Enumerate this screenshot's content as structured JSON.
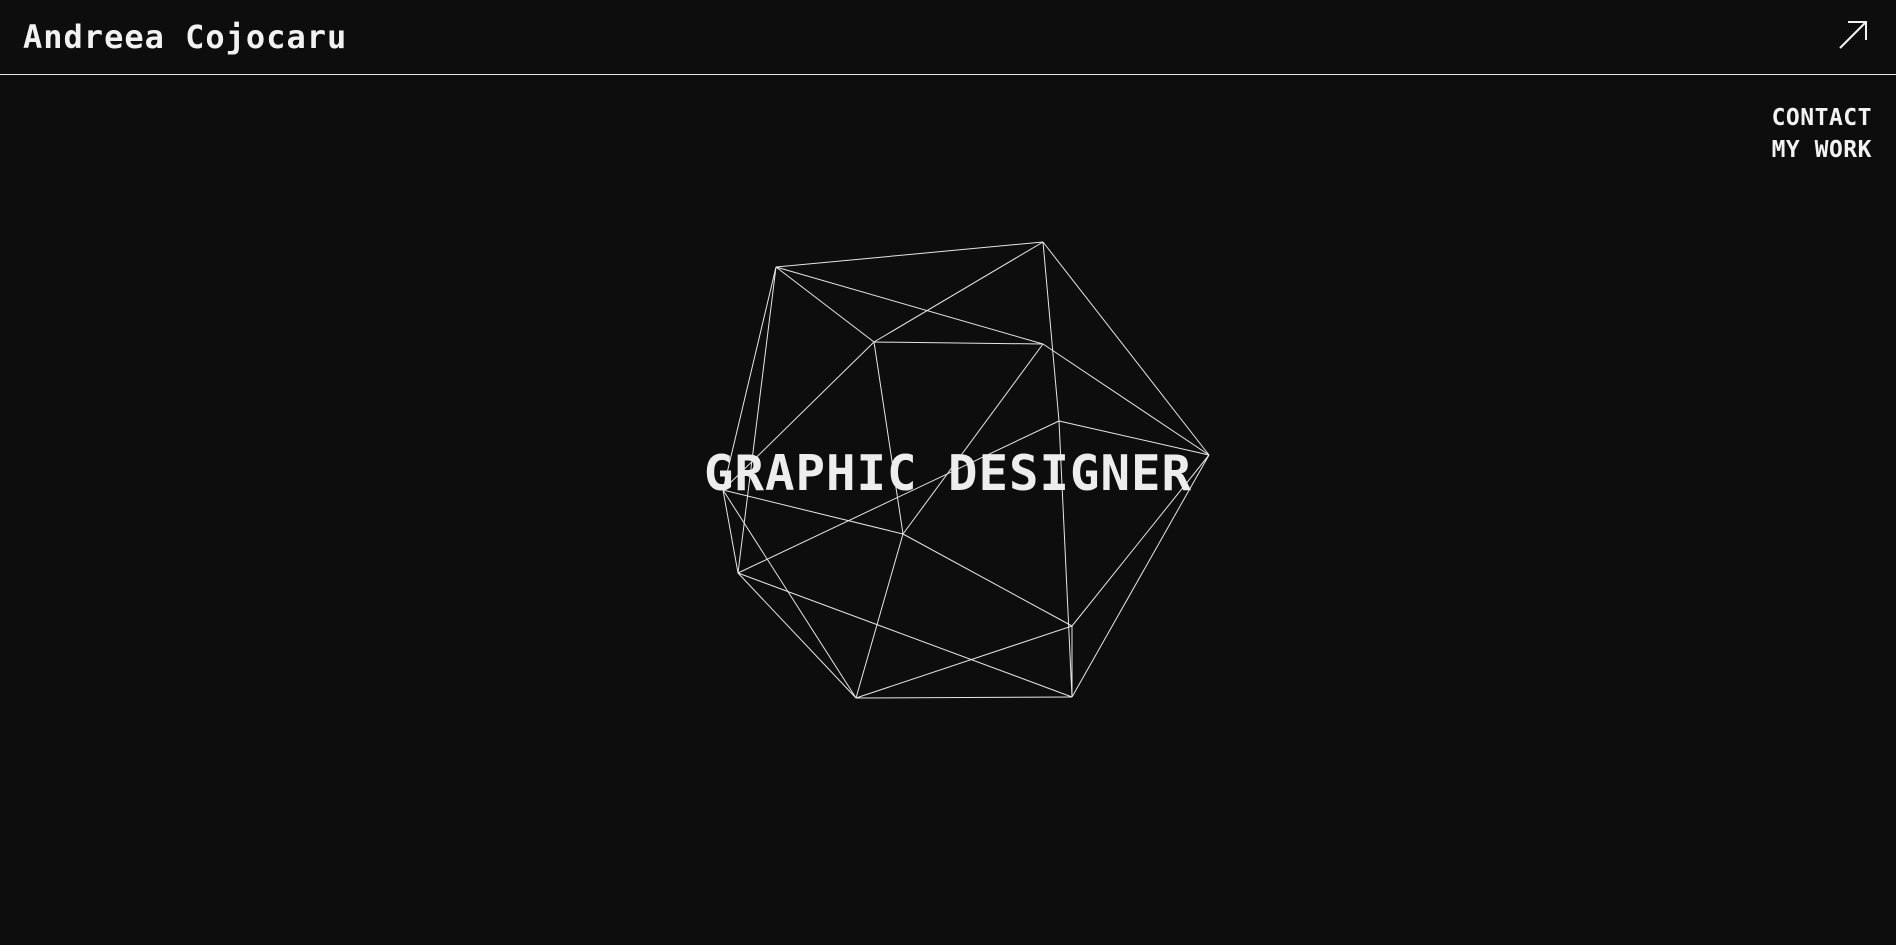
{
  "header": {
    "site_name": "Andreea Cojocaru",
    "external_link_icon": "arrow-up-right-icon"
  },
  "nav": {
    "items": [
      {
        "label": "CONTACT"
      },
      {
        "label": "MY WORK"
      }
    ]
  },
  "hero": {
    "title": "GRAPHIC DESIGNER",
    "graphic": "wireframe-polyhedron"
  },
  "colors": {
    "background": "#0d0d0d",
    "foreground": "#f2f2f2",
    "line": "#e6e6e6"
  }
}
